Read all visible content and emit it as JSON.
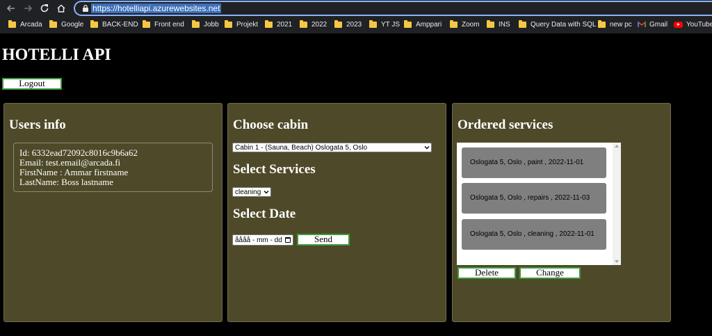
{
  "browser": {
    "url": "https://hotelliapi.azurewebsites.net",
    "bookmarks": [
      {
        "label": "Arcada",
        "icon": "folder-icon"
      },
      {
        "label": "Google",
        "icon": "folder-icon"
      },
      {
        "label": "BACK-END",
        "icon": "folder-icon"
      },
      {
        "label": "Front end",
        "icon": "folder-icon"
      },
      {
        "label": "Jobb",
        "icon": "folder-icon"
      },
      {
        "label": "Projekt",
        "icon": "folder-icon"
      },
      {
        "label": "2021",
        "icon": "folder-icon"
      },
      {
        "label": "2022",
        "icon": "folder-icon"
      },
      {
        "label": "2023",
        "icon": "folder-icon"
      },
      {
        "label": "YT JS",
        "icon": "folder-icon"
      },
      {
        "label": "Amppari",
        "icon": "folder-icon"
      },
      {
        "label": "Zoom",
        "icon": "folder-icon"
      },
      {
        "label": "INS",
        "icon": "folder-icon"
      },
      {
        "label": "Query Data with SQL",
        "icon": "folder-icon"
      },
      {
        "label": "new pc",
        "icon": "folder-icon"
      },
      {
        "label": "Gmail",
        "icon": "gmail-icon"
      },
      {
        "label": "YouTube",
        "icon": "youtube-icon"
      }
    ]
  },
  "page": {
    "title": "HOTELLI API",
    "logout_label": "Logout"
  },
  "users_panel": {
    "heading": "Users info",
    "id_line": "Id: 6332ead72092c8016c9b6a62",
    "email_line": "Email: test.email@arcada.fi",
    "firstname_line": "FirstName : Ammar firstname",
    "lastname_line": "LastName: Boss lastname"
  },
  "cabin_panel": {
    "heading": "Choose cabin",
    "cabin_selected": "Cabin 1 - (Sauna, Beach) Oslogata 5, Oslo",
    "services_heading": "Select Services",
    "service_selected": "cleaning",
    "date_heading": "Select Date",
    "date_placeholder": "åååå - mm - dd",
    "send_label": "Send"
  },
  "orders_panel": {
    "heading": "Ordered services",
    "items": [
      "Oslogata 5, Oslo , paint , 2022-11-01",
      "Oslogata 5, Oslo , repairs , 2022-11-03",
      "Oslogata 5, Oslo , cleaning , 2022-11-01"
    ],
    "delete_label": "Delete",
    "change_label": "Change"
  },
  "colors": {
    "panel_bg": "#4e4a29",
    "button_border": "#3d9a3d",
    "order_item_bg": "#7f7f7f"
  }
}
